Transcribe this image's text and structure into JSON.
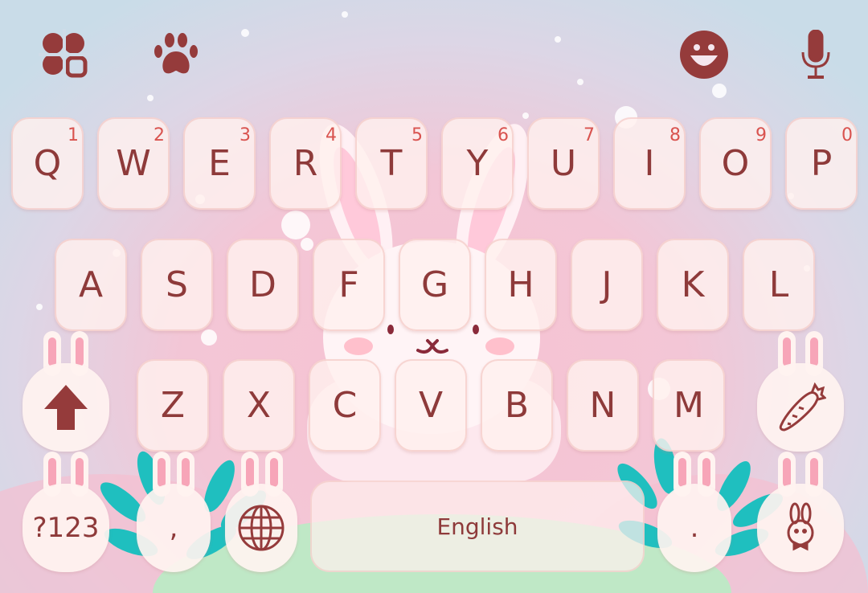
{
  "toolbar": {
    "left_icons": [
      "clover-sticker-icon",
      "paw-theme-icon"
    ],
    "right_icons": [
      "emoji-icon",
      "microphone-icon"
    ]
  },
  "rows": [
    {
      "keys": [
        {
          "label": "Q",
          "hint": "1"
        },
        {
          "label": "W",
          "hint": "2"
        },
        {
          "label": "E",
          "hint": "3"
        },
        {
          "label": "R",
          "hint": "4"
        },
        {
          "label": "T",
          "hint": "5"
        },
        {
          "label": "Y",
          "hint": "6"
        },
        {
          "label": "U",
          "hint": "7"
        },
        {
          "label": "I",
          "hint": "8"
        },
        {
          "label": "O",
          "hint": "9"
        },
        {
          "label": "P",
          "hint": "0"
        }
      ]
    },
    {
      "keys": [
        {
          "label": "A"
        },
        {
          "label": "S"
        },
        {
          "label": "D"
        },
        {
          "label": "F"
        },
        {
          "label": "G"
        },
        {
          "label": "H"
        },
        {
          "label": "J"
        },
        {
          "label": "K"
        },
        {
          "label": "L"
        }
      ]
    },
    {
      "keys": [
        {
          "label": "Z"
        },
        {
          "label": "X"
        },
        {
          "label": "C"
        },
        {
          "label": "V"
        },
        {
          "label": "B"
        },
        {
          "label": "N"
        },
        {
          "label": "M"
        }
      ]
    }
  ],
  "bottom": {
    "symbols": "?123",
    "comma": ",",
    "space": "English",
    "period": "."
  },
  "special_icons": {
    "shift": "shift-arrow-icon",
    "carrot": "carrot-icon",
    "globe": "globe-icon",
    "bunny": "bunny-icon"
  },
  "colors": {
    "key_text": "#8e3a3a",
    "hint_text": "#d9534f",
    "key_bg": "#fff0ee"
  }
}
